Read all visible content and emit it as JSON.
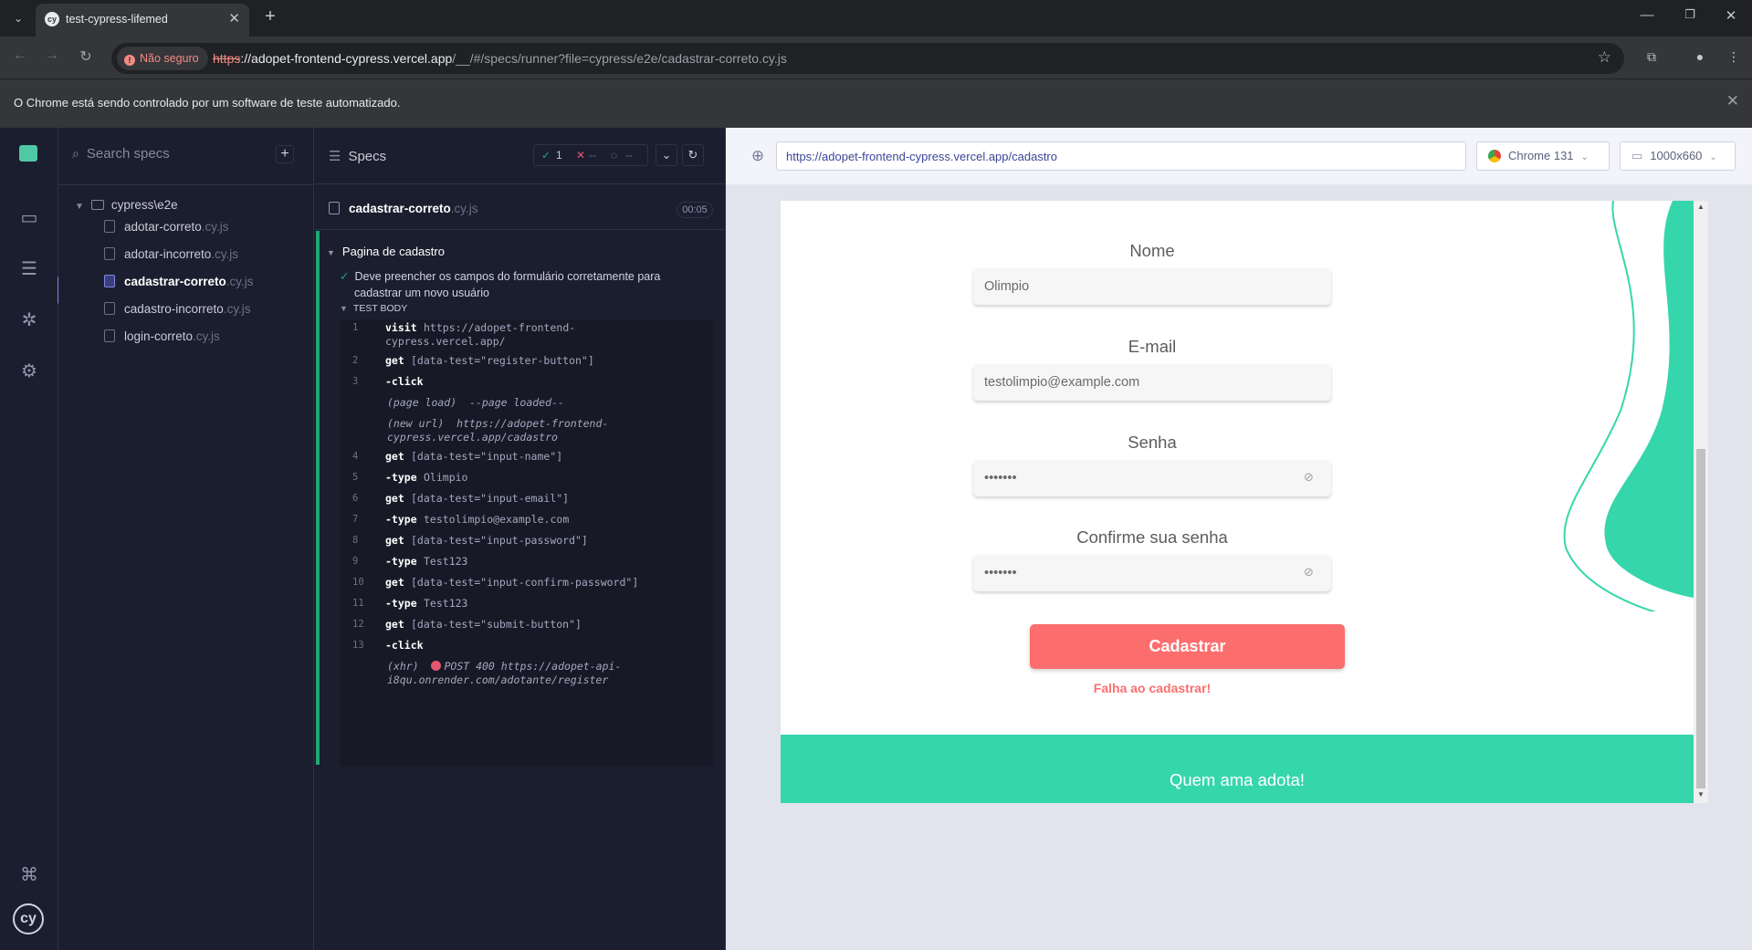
{
  "browser": {
    "tab_title": "test-cypress-lifemed",
    "tab_favicon": "cy",
    "insecure_label": "Não seguro",
    "url_scheme": "https",
    "url_host": "://adopet-frontend-cypress.vercel.app",
    "url_path": "/__/#/specs/runner?file=cypress/e2e/cadastrar-correto.cy.js",
    "automation_message": "O Chrome está sendo controlado por um software de teste automatizado."
  },
  "cypress": {
    "search_placeholder": "Search specs",
    "folder": "cypress\\e2e",
    "files": [
      {
        "name": "adotar-correto",
        "ext": ".cy.js"
      },
      {
        "name": "adotar-incorreto",
        "ext": ".cy.js"
      },
      {
        "name": "cadastrar-correto",
        "ext": ".cy.js"
      },
      {
        "name": "cadastro-incorreto",
        "ext": ".cy.js"
      },
      {
        "name": "login-correto",
        "ext": ".cy.js"
      }
    ],
    "reporter": {
      "header_label": "Specs",
      "passed": "1",
      "failed": "--",
      "pending": "--",
      "spec_name": "cadastrar-correto",
      "spec_ext": ".cy.js",
      "duration": "00:05",
      "suite_title": "Pagina de cadastro",
      "test_title": "Deve preencher os campos do formulário corretamente para cadastrar um novo usuário",
      "body_label": "TEST BODY",
      "commands": [
        {
          "num": "1",
          "name": "visit",
          "arg": "https://adopet-frontend-",
          "arg2": "cypress.vercel.app/"
        },
        {
          "num": "2",
          "name": "get",
          "arg": "[data-test=\"register-button\"]"
        },
        {
          "num": "3",
          "name": "-click",
          "arg": ""
        },
        {
          "num": "",
          "info": "(page load)  --page loaded--"
        },
        {
          "num": "",
          "info": "(new url)  https://adopet-frontend-",
          "info2": "cypress.vercel.app/cadastro"
        },
        {
          "num": "4",
          "name": "get",
          "arg": "[data-test=\"input-name\"]"
        },
        {
          "num": "5",
          "name": "-type",
          "arg": "Olimpio"
        },
        {
          "num": "6",
          "name": "get",
          "arg": "[data-test=\"input-email\"]"
        },
        {
          "num": "7",
          "name": "-type",
          "arg": "testolimpio@example.com"
        },
        {
          "num": "8",
          "name": "get",
          "arg": "[data-test=\"input-password\"]"
        },
        {
          "num": "9",
          "name": "-type",
          "arg": "Test123"
        },
        {
          "num": "10",
          "name": "get",
          "arg": "[data-test=\"input-confirm-password\"]"
        },
        {
          "num": "11",
          "name": "-type",
          "arg": "Test123"
        },
        {
          "num": "12",
          "name": "get",
          "arg": "[data-test=\"submit-button\"]"
        },
        {
          "num": "13",
          "name": "-click",
          "arg": ""
        },
        {
          "num": "",
          "info": "(xhr)  ",
          "xhr": "POST 400 https://adopet-api-",
          "info2": "i8qu.onrender.com/adotante/register"
        }
      ]
    },
    "aut": {
      "url": "https://adopet-frontend-cypress.vercel.app/cadastro",
      "browser": "Chrome 131",
      "viewport": "1000x660"
    }
  },
  "app": {
    "name_label": "Nome",
    "name_value": "Olimpio",
    "email_label": "E-mail",
    "email_value": "testolimpio@example.com",
    "password_label": "Senha",
    "password_value": "•••••••",
    "confirm_label": "Confirme sua senha",
    "confirm_value": "•••••••",
    "submit_label": "Cadastrar",
    "error_message": "Falha ao cadastrar!",
    "footer_slogan": "Quem ama adota!",
    "colors": {
      "accent": "#36d6ad",
      "button": "#fc6e6e"
    }
  }
}
